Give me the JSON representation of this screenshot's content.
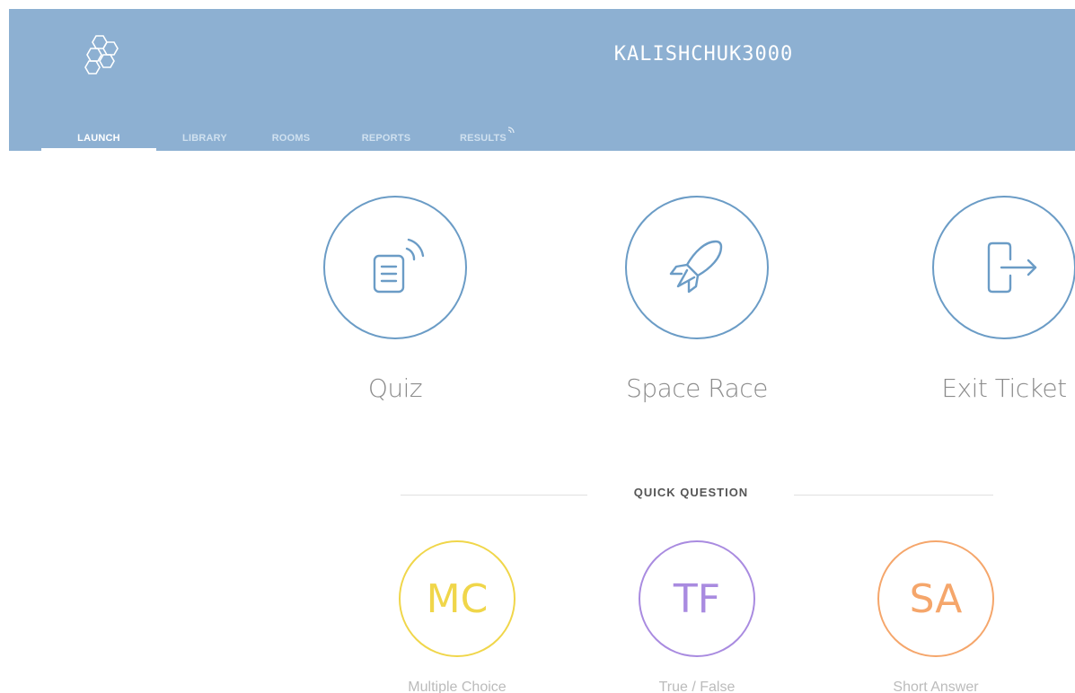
{
  "header": {
    "username": "KALISHCHUK3000",
    "tabs": [
      {
        "label": "LAUNCH",
        "active": true
      },
      {
        "label": "LIBRARY",
        "active": false
      },
      {
        "label": "ROOMS",
        "active": false
      },
      {
        "label": "REPORTS",
        "active": false
      },
      {
        "label": "RESULTS",
        "active": false,
        "badge_icon": "wifi-signal-icon"
      }
    ]
  },
  "launch": {
    "items": [
      {
        "label": "Quiz",
        "icon": "quiz-broadcast-icon"
      },
      {
        "label": "Space Race",
        "icon": "rocket-icon"
      },
      {
        "label": "Exit Ticket",
        "icon": "exit-door-icon"
      }
    ]
  },
  "quick_question": {
    "heading": "QUICK QUESTION",
    "items": [
      {
        "abbr": "MC",
        "label": "Multiple Choice",
        "color": "#f0d64a"
      },
      {
        "abbr": "TF",
        "label": "True / False",
        "color": "#a98be0"
      },
      {
        "abbr": "SA",
        "label": "Short Answer",
        "color": "#f5a66b"
      }
    ]
  },
  "colors": {
    "header_bg": "#8db0d2",
    "accent": "#6b9cc6"
  }
}
